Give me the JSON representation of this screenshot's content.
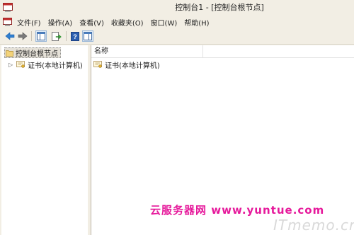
{
  "window": {
    "title": "控制台1 - [控制台根节点]"
  },
  "menu": {
    "items": [
      "文件(F)",
      "操作(A)",
      "查看(V)",
      "收藏夹(O)",
      "窗口(W)",
      "帮助(H)"
    ]
  },
  "toolbar": {
    "buttons": [
      "back-icon",
      "forward-icon",
      "show-hide-tree-icon",
      "export-list-icon",
      "help-icon",
      "action-pane-icon"
    ]
  },
  "tree": {
    "root_label": "控制台根节点",
    "child_label": "证书(本地计算机)"
  },
  "list": {
    "column_name": "名称",
    "rows": [
      "证书(本地计算机)"
    ]
  },
  "watermark": {
    "line1": "云服务器网 www.yuntue.com",
    "line2": "ITmemo.cn"
  }
}
